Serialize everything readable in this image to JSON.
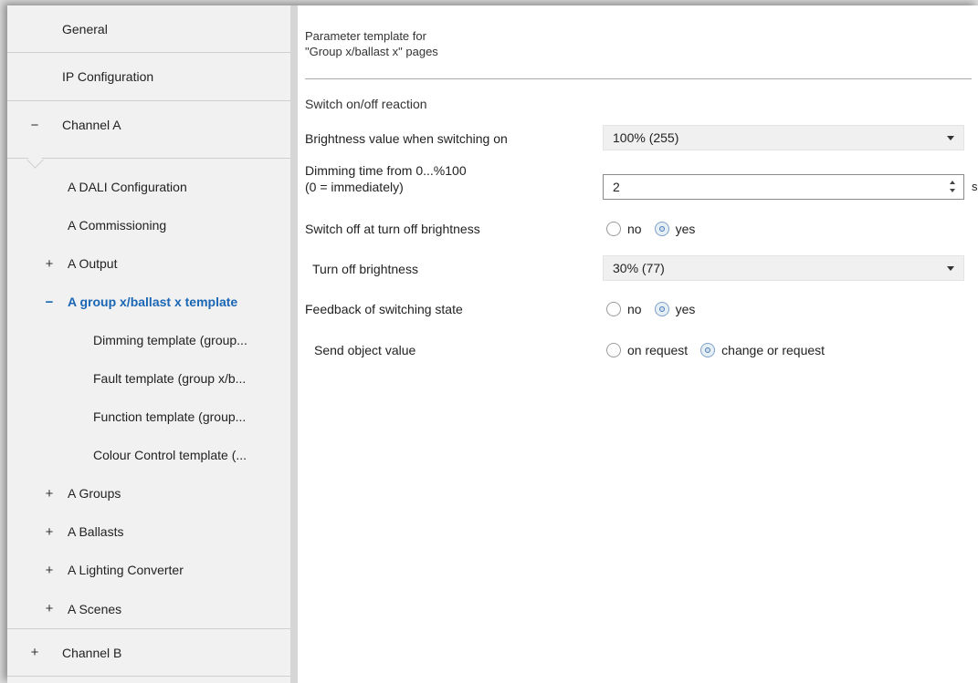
{
  "sidebar": {
    "items": [
      {
        "sign": "",
        "label": "General"
      },
      {
        "sign": "",
        "label": "IP Configuration"
      },
      {
        "sign": "−",
        "label": "Channel A"
      },
      {
        "sign": "",
        "label": "A DALI Configuration"
      },
      {
        "sign": "",
        "label": "A Commissioning"
      },
      {
        "sign": "+",
        "label": "A Output"
      },
      {
        "sign": "−",
        "label": "A group x/ballast x template"
      },
      {
        "sign": "",
        "label": "Dimming template (group..."
      },
      {
        "sign": "",
        "label": "Fault template  (group x/b..."
      },
      {
        "sign": "",
        "label": "Function template (group..."
      },
      {
        "sign": "",
        "label": "Colour Control template (..."
      },
      {
        "sign": "+",
        "label": "A Groups"
      },
      {
        "sign": "+",
        "label": "A Ballasts"
      },
      {
        "sign": "+",
        "label": "A Lighting Converter"
      },
      {
        "sign": "+",
        "label": "A Scenes"
      },
      {
        "sign": "+",
        "label": "Channel B"
      }
    ]
  },
  "main": {
    "title_line1": "Parameter template for",
    "title_line2": "\"Group x/ballast x\" pages",
    "section": "Switch on/off reaction",
    "brightness_on": {
      "label": "Brightness value when switching on",
      "value": "100% (255)"
    },
    "dimming_time": {
      "label_line1": "Dimming time from 0...%100",
      "label_line2": "(0 = immediately)",
      "value": "2",
      "unit": "s"
    },
    "switch_off": {
      "label": "Switch off at turn off brightness",
      "options": [
        "no",
        "yes"
      ],
      "selected": 1
    },
    "turn_off_brightness": {
      "label": "Turn off brightness",
      "value": "30% (77)"
    },
    "feedback": {
      "label": "Feedback of switching state",
      "options": [
        "no",
        "yes"
      ],
      "selected": 1
    },
    "send_object": {
      "label": "Send object value",
      "options": [
        "on request",
        "change or request"
      ],
      "selected": 1
    }
  },
  "colors": {
    "accent": "#1a66b5",
    "sidebar_bg": "#f1f1f1",
    "select_bg": "#f0f0f0"
  }
}
